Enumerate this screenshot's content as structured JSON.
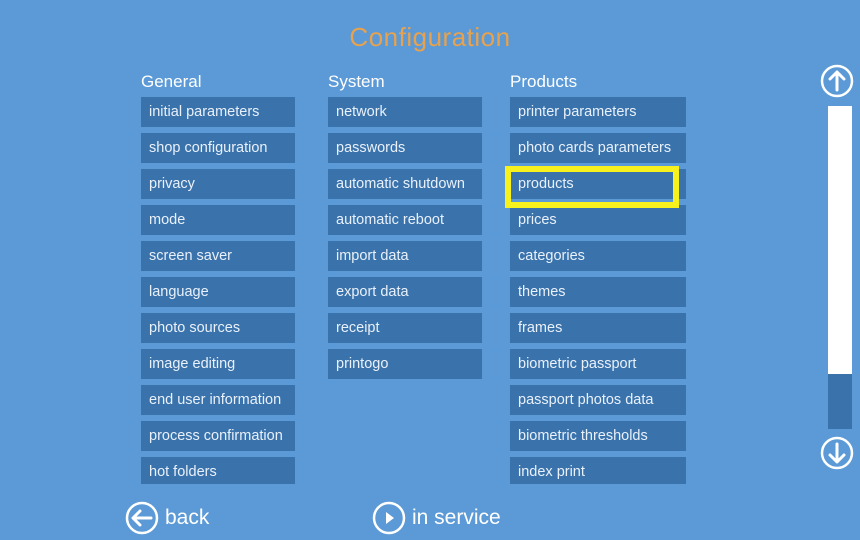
{
  "title": "Configuration",
  "columns": {
    "general": {
      "header": "General",
      "items": [
        "initial parameters",
        "shop configuration",
        "privacy",
        "mode",
        "screen saver",
        "language",
        "photo sources",
        "image editing",
        "end user information",
        "process confirmation",
        "hot folders"
      ]
    },
    "system": {
      "header": "System",
      "items": [
        "network",
        "passwords",
        "automatic shutdown",
        "automatic reboot",
        "import data",
        "export data",
        "receipt",
        "printogo"
      ]
    },
    "products": {
      "header": "Products",
      "items": [
        "printer parameters",
        "photo cards parameters",
        "products",
        "prices",
        "categories",
        "themes",
        "frames",
        "biometric passport",
        "passport photos data",
        "biometric thresholds",
        "index print"
      ]
    }
  },
  "scrollbar": {
    "position": 0.83,
    "thumb_fraction": 0.17
  },
  "footer": {
    "back_label": "back",
    "in_service_label": "in service"
  },
  "colors": {
    "background": "#5b9ad6",
    "button": "#3a72ab",
    "title": "#e8a24e",
    "highlight": "#f7f21e"
  },
  "icons": {
    "scroll_up": "arrow-up-circle-icon",
    "scroll_down": "arrow-down-circle-icon",
    "back": "arrow-left-circle-icon",
    "in_service": "play-circle-icon"
  }
}
